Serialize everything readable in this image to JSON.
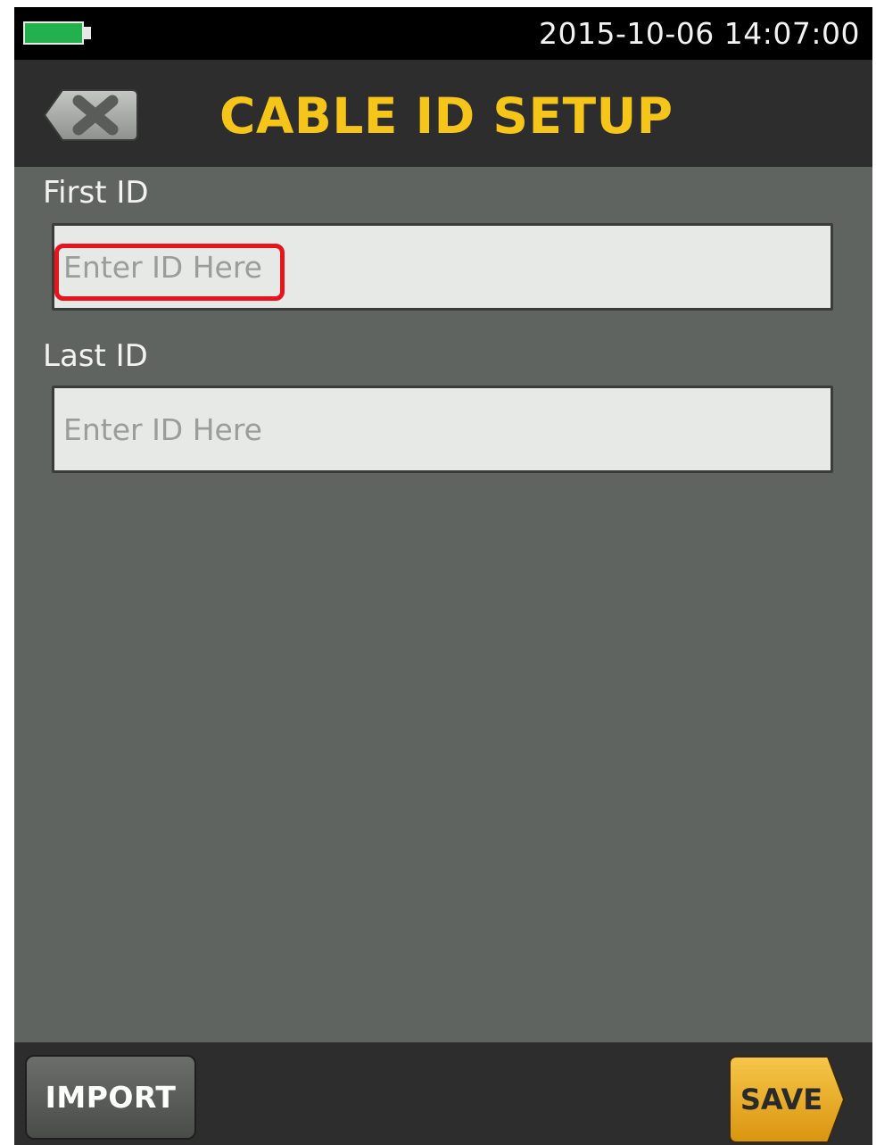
{
  "status_bar": {
    "datetime": "2015-10-06 14:07:00",
    "battery_icon": "battery-full-icon",
    "battery_color": "#22b14c"
  },
  "header": {
    "title": "CABLE ID SETUP",
    "back_icon": "close-icon",
    "title_color": "#f5c51a"
  },
  "form": {
    "first_id": {
      "label": "First ID",
      "placeholder": "Enter ID Here",
      "value": ""
    },
    "last_id": {
      "label": "Last ID",
      "placeholder": "Enter ID Here",
      "value": ""
    }
  },
  "footer": {
    "import_label": "IMPORT",
    "save_label": "SAVE",
    "save_color": "#f2b320"
  },
  "annotation": {
    "highlight_color": "#e8141c"
  }
}
